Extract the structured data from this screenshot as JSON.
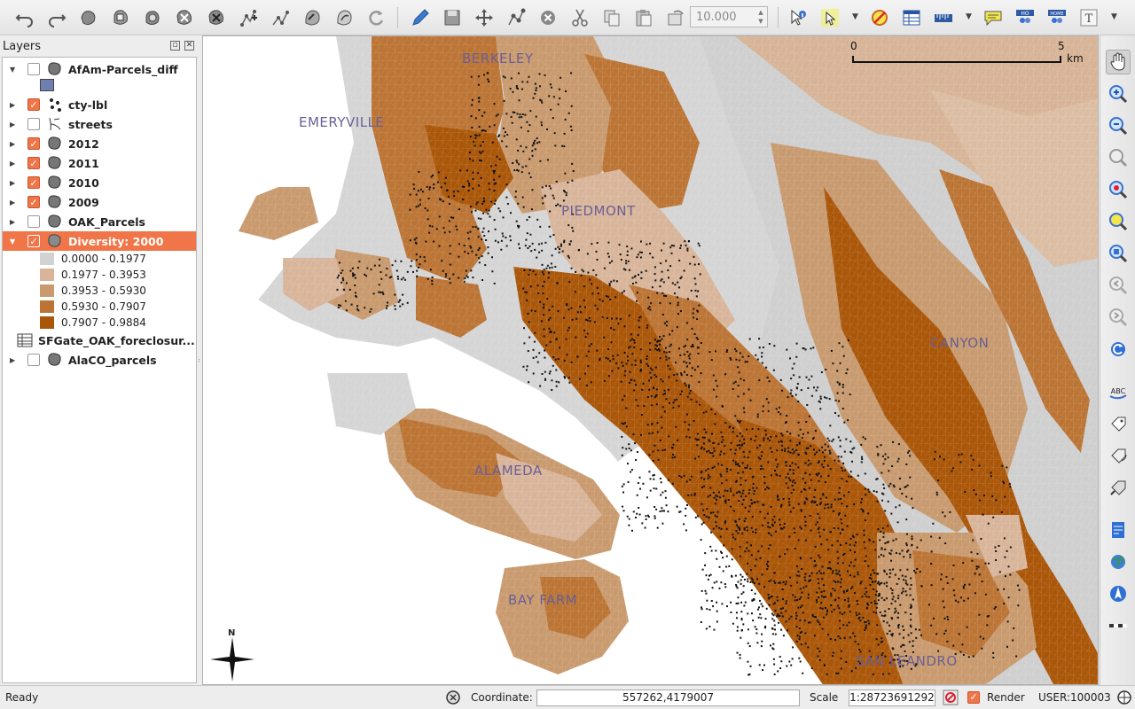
{
  "toolbar": {
    "scale_value": "10.000",
    "buttons": [
      "undo-icon",
      "redo-icon",
      "digitize-icon",
      "node-tool-icon",
      "simplify-icon",
      "add-ring-icon",
      "delete-ring-icon",
      "split-icon",
      "merge-icon",
      "offset-icon",
      "rotate-icon",
      "reshape-icon",
      "edit-pencil-icon",
      "save-edits-icon",
      "move-feature-icon",
      "node-edit-icon",
      "delete-selected-icon",
      "cut-icon",
      "copy-icon",
      "paste-icon",
      "rotate-point-icon",
      "identify-icon",
      "select-icon",
      "deselect-icon",
      "attribute-table-icon",
      "measure-icon",
      "map-tips-icon",
      "home-icon",
      "home-alt-icon",
      "text-annotation-icon"
    ]
  },
  "layers_panel": {
    "title": "Layers",
    "items": [
      {
        "name": "AfAm-Parcels_diff",
        "checked": false,
        "expanded": true,
        "icon": "polygon-layer-icon"
      },
      {
        "name": "cty-lbl",
        "checked": true,
        "expanded": false,
        "icon": "point-layer-icon"
      },
      {
        "name": "streets",
        "checked": false,
        "expanded": false,
        "icon": "line-layer-icon"
      },
      {
        "name": "2012",
        "checked": true,
        "expanded": false,
        "icon": "polygon-layer-icon"
      },
      {
        "name": "2011",
        "checked": true,
        "expanded": false,
        "icon": "polygon-layer-icon"
      },
      {
        "name": "2010",
        "checked": true,
        "expanded": false,
        "icon": "polygon-layer-icon"
      },
      {
        "name": "2009",
        "checked": true,
        "expanded": false,
        "icon": "polygon-layer-icon"
      },
      {
        "name": "OAK_Parcels",
        "checked": false,
        "expanded": false,
        "icon": "polygon-layer-icon"
      },
      {
        "name": "Diversity: 2000",
        "checked": true,
        "expanded": true,
        "selected": true,
        "icon": "polygon-layer-icon"
      },
      {
        "name": "SFGate_OAK_foreclosur...",
        "checked": null,
        "expanded": null,
        "icon": "table-layer-icon"
      },
      {
        "name": "AlaCO_parcels",
        "checked": false,
        "expanded": false,
        "icon": "polygon-layer-icon"
      }
    ],
    "afam_swatch_color": "#6f7fb0",
    "legend": [
      {
        "label": "0.0000 - 0.1977",
        "color": "#d2d2d2"
      },
      {
        "label": "0.1977 - 0.3953",
        "color": "#d8b59a"
      },
      {
        "label": "0.3953 - 0.5930",
        "color": "#c99a6e"
      },
      {
        "label": "0.5930 - 0.7907",
        "color": "#bb7434"
      },
      {
        "label": "0.7907 - 0.9884",
        "color": "#aa5608"
      }
    ]
  },
  "map": {
    "place_labels": [
      "BERKELEY",
      "EMERYVILLE",
      "PIEDMONT",
      "CANYON",
      "ALAMEDA",
      "BAY FARM",
      "SAN LEANDRO"
    ],
    "scalebar": {
      "start": "0",
      "end": "5",
      "unit": "km"
    },
    "north_label": "N"
  },
  "status_bar": {
    "status": "Ready",
    "coordinate_label": "Coordinate:",
    "coordinate_value": "557262,4179007",
    "scale_label": "Scale",
    "scale_value": "1:28723691292",
    "render_label": "Render",
    "crs": "USER:100003"
  }
}
